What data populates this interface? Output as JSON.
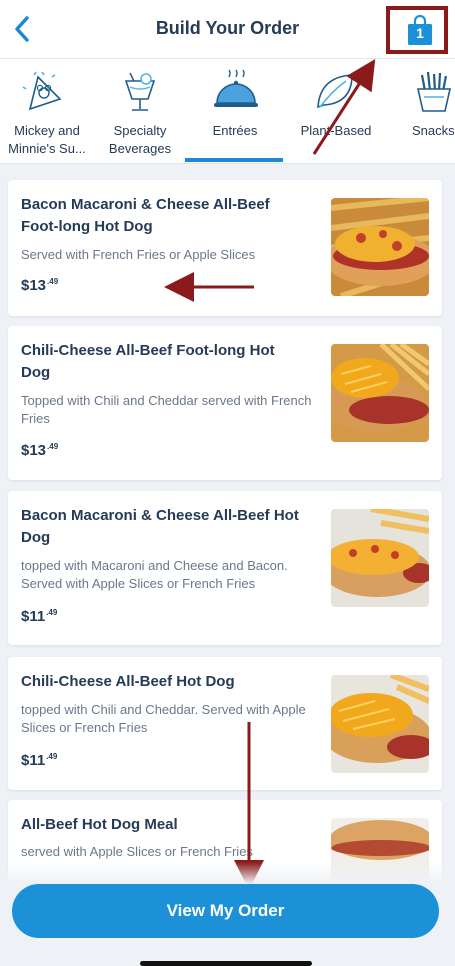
{
  "header": {
    "title": "Build Your Order",
    "back_icon": "chevron-left-icon",
    "bag_icon": "shopping-bag-icon",
    "bag_count": "1"
  },
  "tabs": [
    {
      "label": "Mickey and\nMinnie's Su...",
      "icon": "mickey-cone-icon"
    },
    {
      "label": "Specialty\nBeverages",
      "icon": "beverage-icon"
    },
    {
      "label": "Entrées",
      "icon": "cloche-icon",
      "selected": true
    },
    {
      "label": "Plant-Based",
      "icon": "leaf-icon"
    },
    {
      "label": "Snacks",
      "icon": "fries-icon"
    }
  ],
  "items": [
    {
      "name": "Bacon Macaroni & Cheese All-Beef Foot-long Hot Dog",
      "description": "Served with French Fries or Apple Slices",
      "price_main": "$13",
      "price_cents": ".49"
    },
    {
      "name": "Chili-Cheese All-Beef Foot-long Hot Dog",
      "description": "Topped with Chili and Cheddar served with French Fries",
      "price_main": "$13",
      "price_cents": ".49"
    },
    {
      "name": "Bacon Macaroni & Cheese All-Beef Hot Dog",
      "description": "topped with Macaroni and Cheese and Bacon. Served with Apple Slices or French Fries",
      "price_main": "$11",
      "price_cents": ".49"
    },
    {
      "name": "Chili-Cheese All-Beef Hot Dog",
      "description": "topped with Chili and Cheddar. Served with Apple Slices or French Fries",
      "price_main": "$11",
      "price_cents": ".49"
    },
    {
      "name": "All-Beef Hot Dog Meal",
      "description": "served with Apple Slices or French Fries"
    }
  ],
  "footer": {
    "view_order_label": "View My Order"
  },
  "colors": {
    "accent": "#1d91d8",
    "text": "#253b56",
    "annotation": "#8b1a1a"
  }
}
